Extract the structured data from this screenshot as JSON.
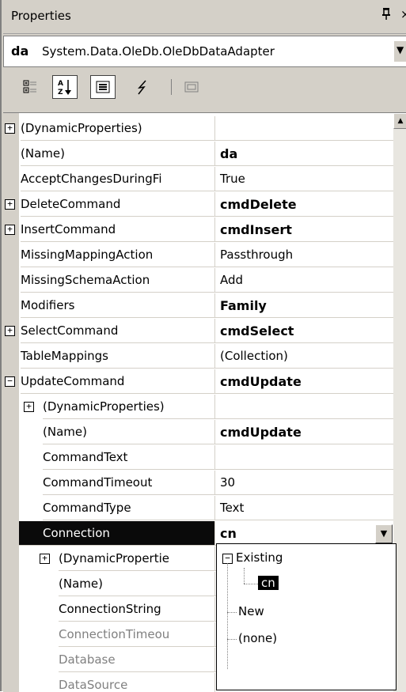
{
  "window": {
    "title": "Properties",
    "pin_glyph": "ꟹ",
    "close_glyph": "×"
  },
  "selector": {
    "object_name": "da",
    "object_type": "System.Data.OleDb.OleDbDataAdapter"
  },
  "toolbar": {
    "buttons": [
      "categorized",
      "alphabetical",
      "properties",
      "events",
      "property-pages"
    ],
    "pressed": "alphabetical"
  },
  "properties": [
    {
      "name": "(DynamicProperties)",
      "value": "",
      "expander": "+",
      "level": 0
    },
    {
      "name": "(Name)",
      "value": "da",
      "bold": true,
      "level": 0
    },
    {
      "name": "AcceptChangesDuringFi",
      "value": "True",
      "level": 0
    },
    {
      "name": "DeleteCommand",
      "value": "cmdDelete",
      "bold": true,
      "expander": "+",
      "level": 0
    },
    {
      "name": "InsertCommand",
      "value": "cmdInsert",
      "bold": true,
      "expander": "+",
      "level": 0
    },
    {
      "name": "MissingMappingAction",
      "value": "Passthrough",
      "level": 0
    },
    {
      "name": "MissingSchemaAction",
      "value": "Add",
      "level": 0
    },
    {
      "name": "Modifiers",
      "value": "Family",
      "bold": true,
      "level": 0
    },
    {
      "name": "SelectCommand",
      "value": "cmdSelect",
      "bold": true,
      "expander": "+",
      "level": 0
    },
    {
      "name": "TableMappings",
      "value": "(Collection)",
      "level": 0
    },
    {
      "name": "UpdateCommand",
      "value": "cmdUpdate",
      "bold": true,
      "expander": "−",
      "level": 0
    },
    {
      "name": "(DynamicProperties)",
      "value": "",
      "expander": "+",
      "level": 1
    },
    {
      "name": "(Name)",
      "value": "cmdUpdate",
      "bold": true,
      "level": 1
    },
    {
      "name": "CommandText",
      "value": "",
      "level": 1
    },
    {
      "name": "CommandTimeout",
      "value": "30",
      "level": 1
    },
    {
      "name": "CommandType",
      "value": "Text",
      "level": 1
    },
    {
      "name": "Connection",
      "value": "cn",
      "bold": true,
      "expander": "−",
      "level": 1,
      "selected": true
    },
    {
      "name": "(DynamicPropertie",
      "value": "",
      "expander": "+",
      "level": 2
    },
    {
      "name": "(Name)",
      "value": "",
      "level": 2
    },
    {
      "name": "ConnectionString",
      "value": "",
      "level": 2
    },
    {
      "name": "ConnectionTimeou",
      "value": "",
      "level": 2,
      "gray": true
    },
    {
      "name": "Database",
      "value": "",
      "level": 2,
      "gray": true
    },
    {
      "name": "DataSource",
      "value": "",
      "level": 2,
      "gray": true
    }
  ],
  "dropdown": {
    "items": [
      {
        "label": "Existing",
        "expander": "−"
      },
      {
        "label": "cn",
        "selected": true
      },
      {
        "label": "New"
      },
      {
        "label": "(none)"
      }
    ]
  }
}
